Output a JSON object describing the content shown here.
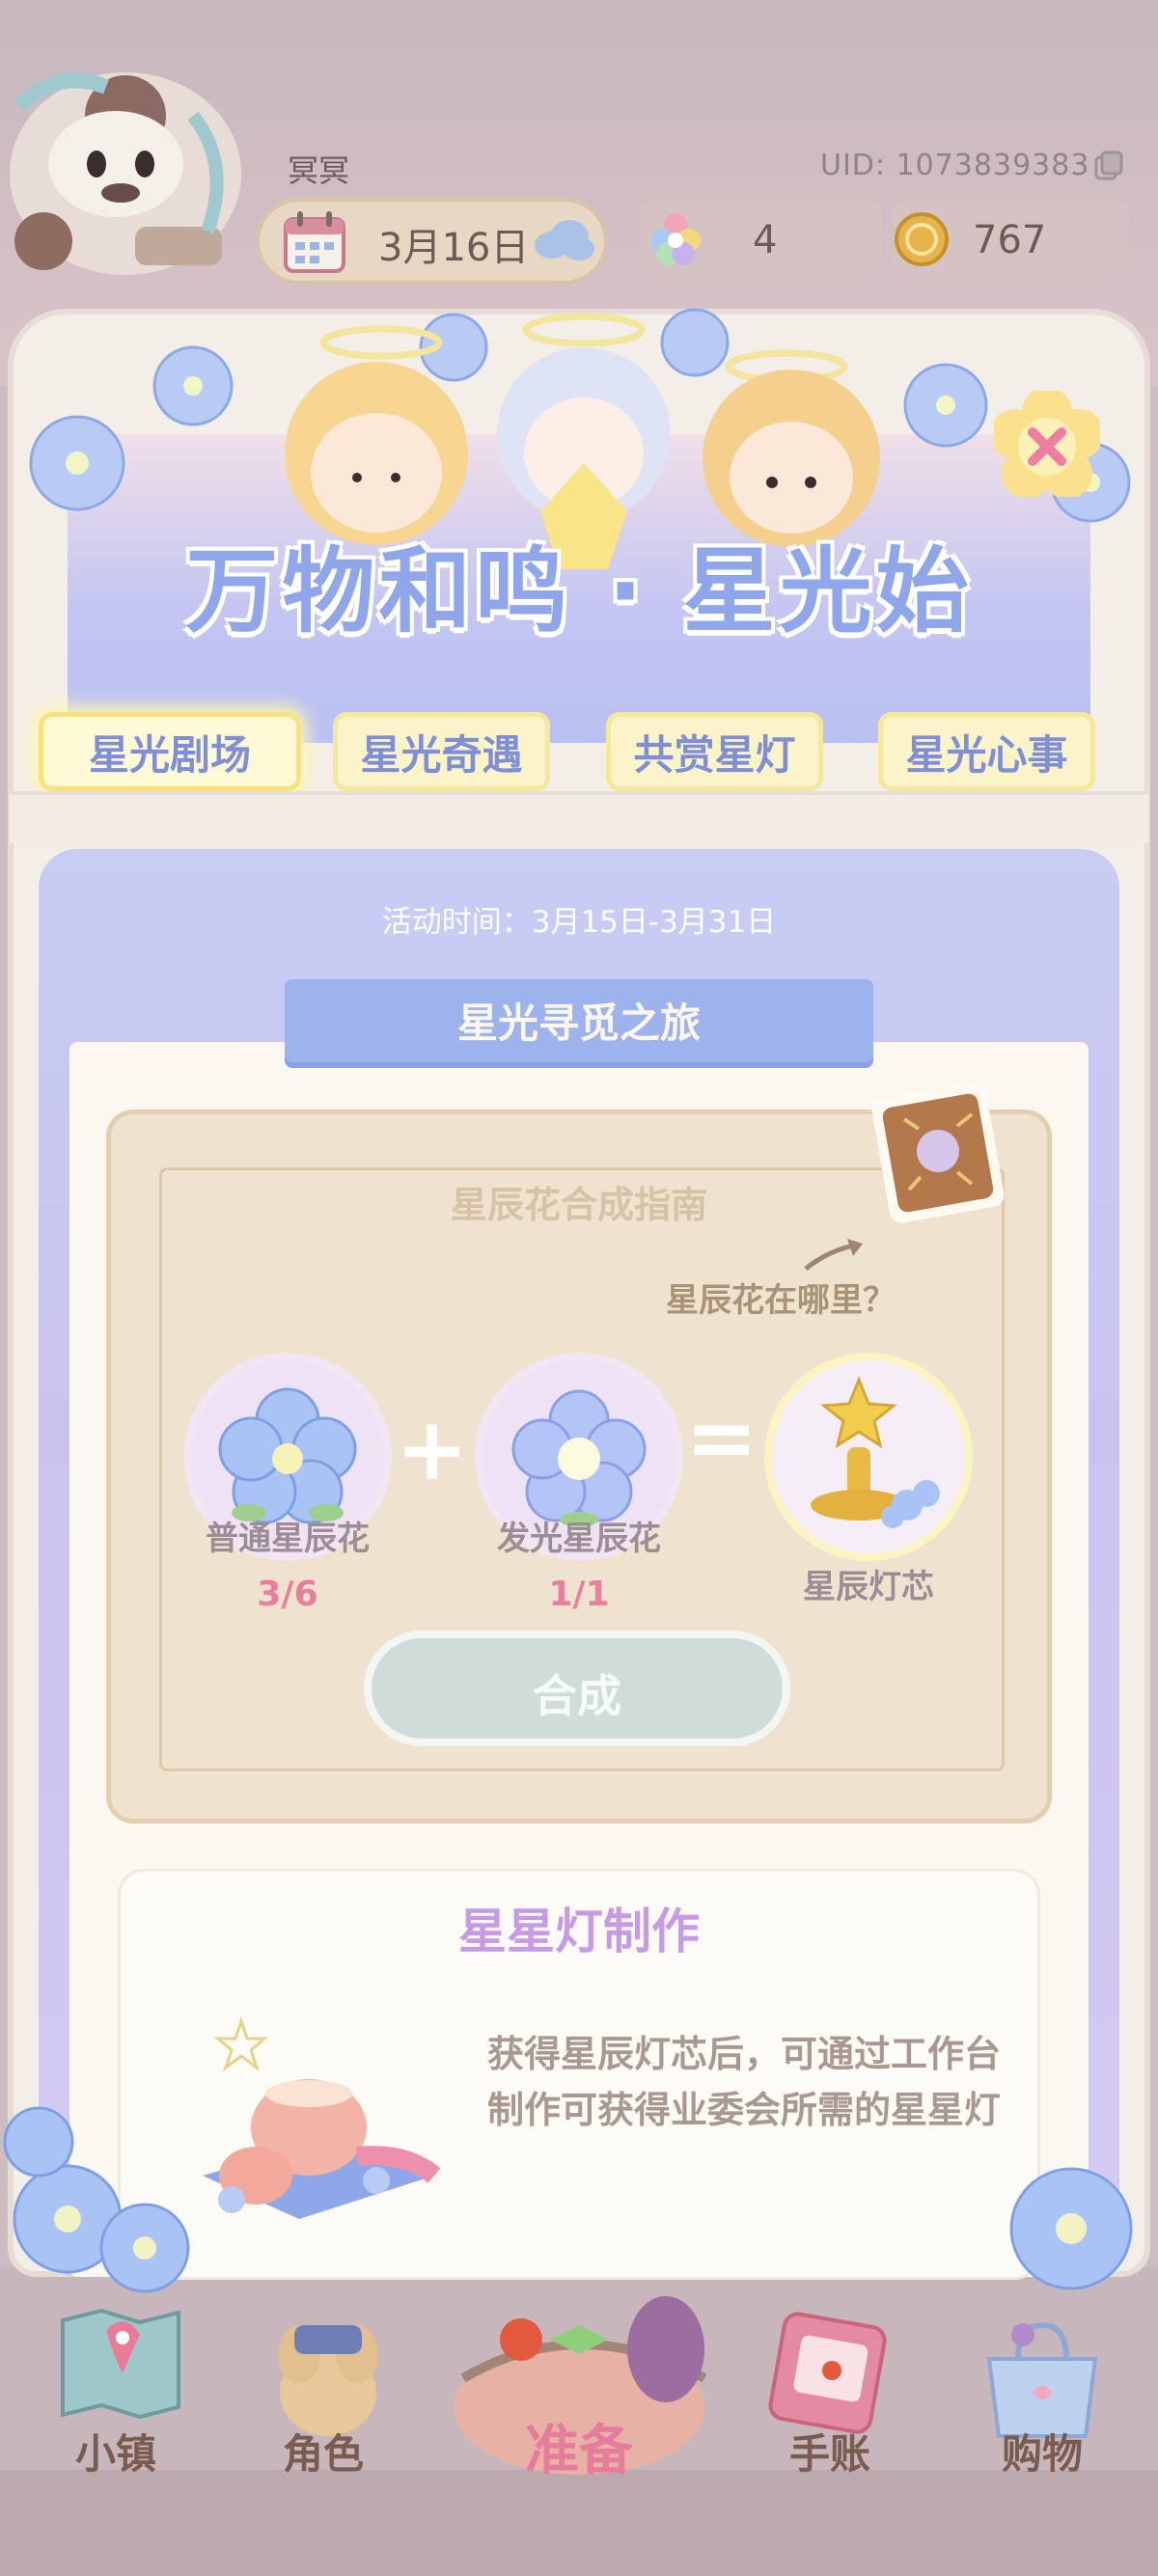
{
  "top_bar": {
    "player_name": "冥冥",
    "uid": "UID: 1073839383",
    "date": "3月16日",
    "gems": "4",
    "coins": "767",
    "icons": [
      "avatar",
      "calendar-icon",
      "cloud-icon",
      "gem-icon",
      "coin-icon",
      "copy-icon"
    ]
  },
  "event": {
    "title": "万物和鸣 · 星光始",
    "tabs": [
      "星光剧场",
      "星光奇遇",
      "共赏星灯",
      "星光心事"
    ],
    "active_tab": "星光剧场",
    "time": "活动时间：3月15日-3月31日",
    "section_title": "星光寻觅之旅"
  },
  "guide": {
    "title": "星辰花合成指南",
    "hint": "星辰花在哪里？",
    "items": [
      {
        "label": "普通星辰花",
        "count": "3/6"
      },
      {
        "label": "发光星辰花",
        "count": "1/1"
      },
      {
        "label": "星辰灯芯",
        "count": ""
      }
    ],
    "plus": "+",
    "equals": "=",
    "craft_label": "合成"
  },
  "lamp": {
    "title": "星星灯制作",
    "description": "获得星辰灯芯后，可通过工作台制作可获得业委会所需的星星灯"
  },
  "nav": [
    {
      "label": "小镇",
      "icon": "map-icon"
    },
    {
      "label": "角色",
      "icon": "character-icon"
    },
    {
      "label": "准备",
      "icon": "basket-icon"
    },
    {
      "label": "手账",
      "icon": "notebook-icon"
    },
    {
      "label": "购物",
      "icon": "shopping-bag-icon"
    }
  ],
  "colors": {
    "title": "#8fa6ea",
    "tab_bg": "#fbf4c9",
    "count_pink": "#ea7e9f",
    "lamp_title": "#c79ae6",
    "nav_active": "#e57b9d"
  }
}
